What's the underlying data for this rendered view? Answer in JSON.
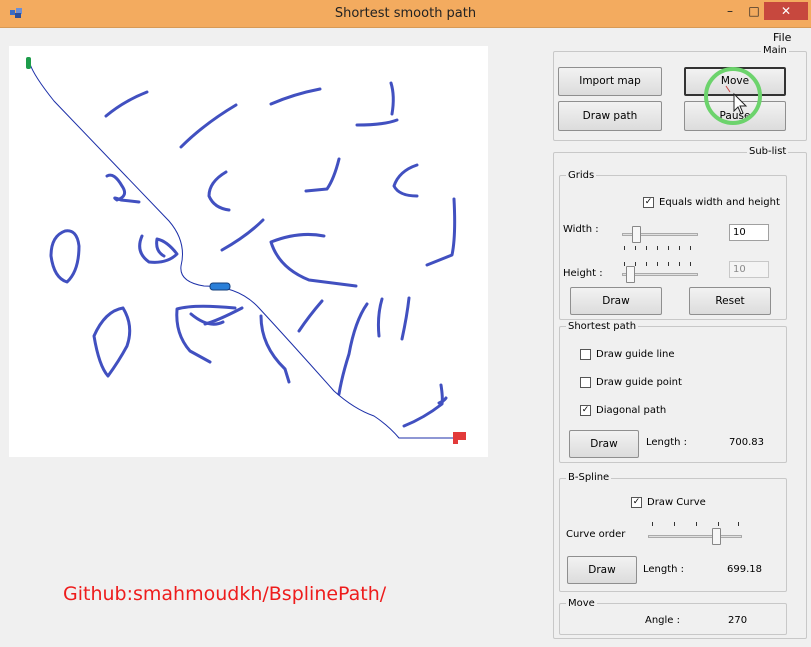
{
  "window": {
    "title": "Shortest smooth path",
    "min_glyph": "–",
    "max_glyph": "□",
    "close_glyph": "✕"
  },
  "menu": {
    "file": "File"
  },
  "watermark": "Github:smahmoudkh/BsplinePath/",
  "main": {
    "label": "Main",
    "import_map": "Import map",
    "move": "Move",
    "draw_path": "Draw path",
    "pause": "Pause"
  },
  "sublist": {
    "label": "Sub-list"
  },
  "grids": {
    "label": "Grids",
    "equals_checked": true,
    "equals_label": "Equals  width and height",
    "width_label": "Width :",
    "width_value": "10",
    "height_label": "Height :",
    "height_value": "10",
    "draw": "Draw",
    "reset": "Reset"
  },
  "shortest_path": {
    "label": "Shortest path",
    "guide_line": {
      "label": "Draw guide line",
      "checked": false
    },
    "guide_point": {
      "label": "Draw guide point",
      "checked": false
    },
    "diagonal": {
      "label": "Diagonal path",
      "checked": true
    },
    "draw": "Draw",
    "length_label": "Length :",
    "length_value": "700.83"
  },
  "bspline": {
    "label": "B-Spline",
    "draw_curve": {
      "label": "Draw Curve",
      "checked": true
    },
    "curve_order_label": "Curve order",
    "draw": "Draw",
    "length_label": "Length :",
    "length_value": "699.18"
  },
  "move": {
    "label": "Move",
    "angle_label": "Angle :",
    "angle_value": "270"
  },
  "colors": {
    "obstacle": "#4150c0",
    "path": "#1c2fa8",
    "start_marker": "#1d9c4a",
    "goal_marker": "#e23a3a",
    "vehicle": "#2a7fd8",
    "highlight": "#6cd36c"
  }
}
